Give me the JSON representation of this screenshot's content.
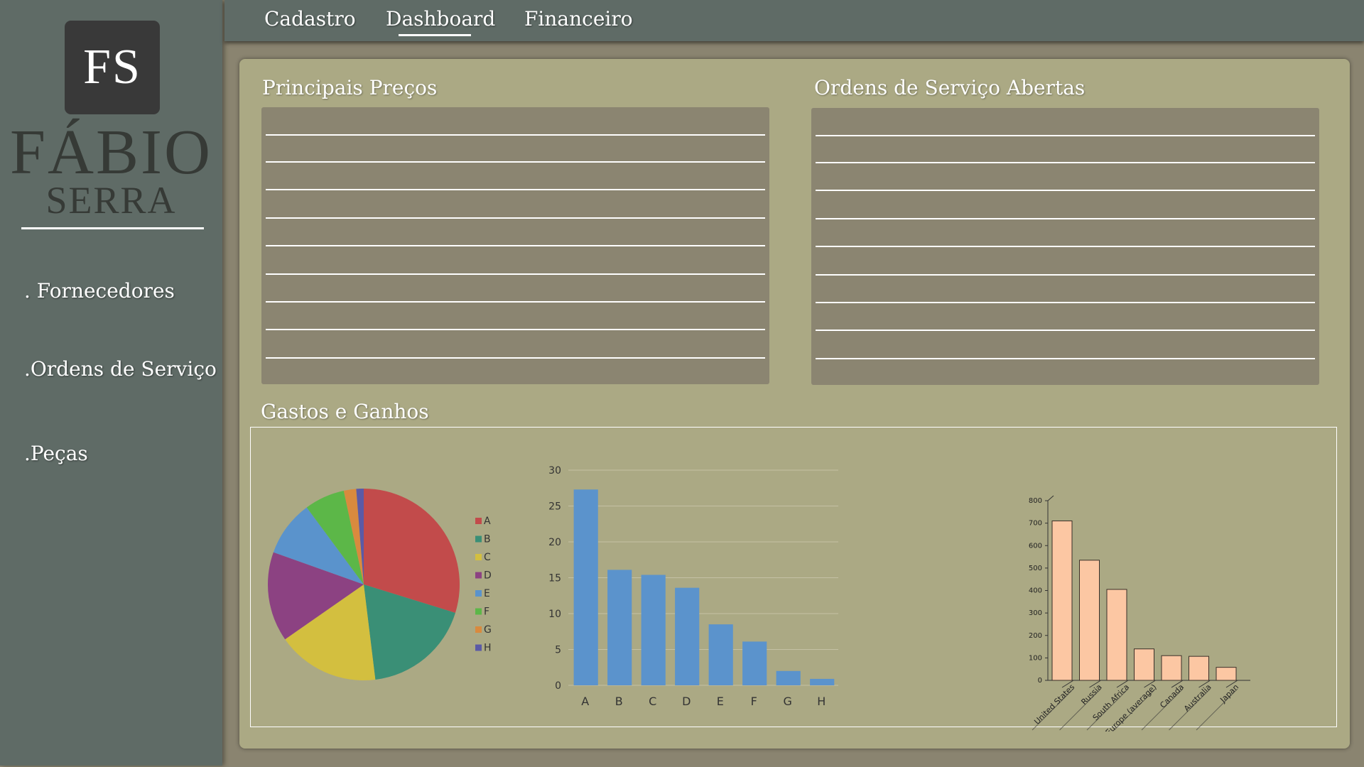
{
  "logo": {
    "initials": "FS",
    "first_name": "FÁBIO",
    "last_name": "SERRA"
  },
  "sidebar": {
    "items": [
      {
        "label": ". Fornecedores"
      },
      {
        "label": ".Ordens de Serviço"
      },
      {
        "label": ".Peças"
      }
    ]
  },
  "topnav": {
    "tabs": [
      {
        "label": "Cadastro"
      },
      {
        "label": "Dashboard",
        "active": true
      },
      {
        "label": "Financeiro"
      }
    ]
  },
  "sections": {
    "prices_title": "Principais Preços",
    "orders_title": "Ordens de Serviço Abertas",
    "charts_title": "Gastos e Ganhos"
  },
  "chart_data": [
    {
      "type": "pie",
      "categories": [
        "A",
        "B",
        "C",
        "D",
        "E",
        "F",
        "G",
        "H"
      ],
      "values": [
        28.5,
        17.5,
        16.5,
        14.5,
        9,
        6.5,
        2,
        1.2
      ],
      "colors": [
        "#c24b4b",
        "#3a8f76",
        "#d3bf3f",
        "#8c4282",
        "#5a93cc",
        "#5cb748",
        "#d98a3e",
        "#5b5aa6"
      ],
      "legend": "right"
    },
    {
      "type": "bar",
      "categories": [
        "A",
        "B",
        "C",
        "D",
        "E",
        "F",
        "G",
        "H"
      ],
      "values": [
        27.3,
        16.1,
        15.4,
        13.6,
        8.5,
        6.1,
        2.0,
        0.9
      ],
      "ylim": [
        0,
        30
      ],
      "yticks": [
        0,
        5,
        10,
        15,
        20,
        25,
        30
      ],
      "color": "#5b93cc",
      "grid": true
    },
    {
      "type": "bar",
      "categories": [
        "United States",
        "Russia",
        "South Africa",
        "Europe (average)",
        "Canada",
        "Australia",
        "Japan"
      ],
      "values": [
        710,
        535,
        405,
        140,
        110,
        107,
        58
      ],
      "ylim": [
        0,
        800
      ],
      "yticks": [
        0,
        100,
        200,
        300,
        400,
        500,
        600,
        700,
        800
      ],
      "color": "#fcc7a3",
      "style": "3d"
    }
  ]
}
